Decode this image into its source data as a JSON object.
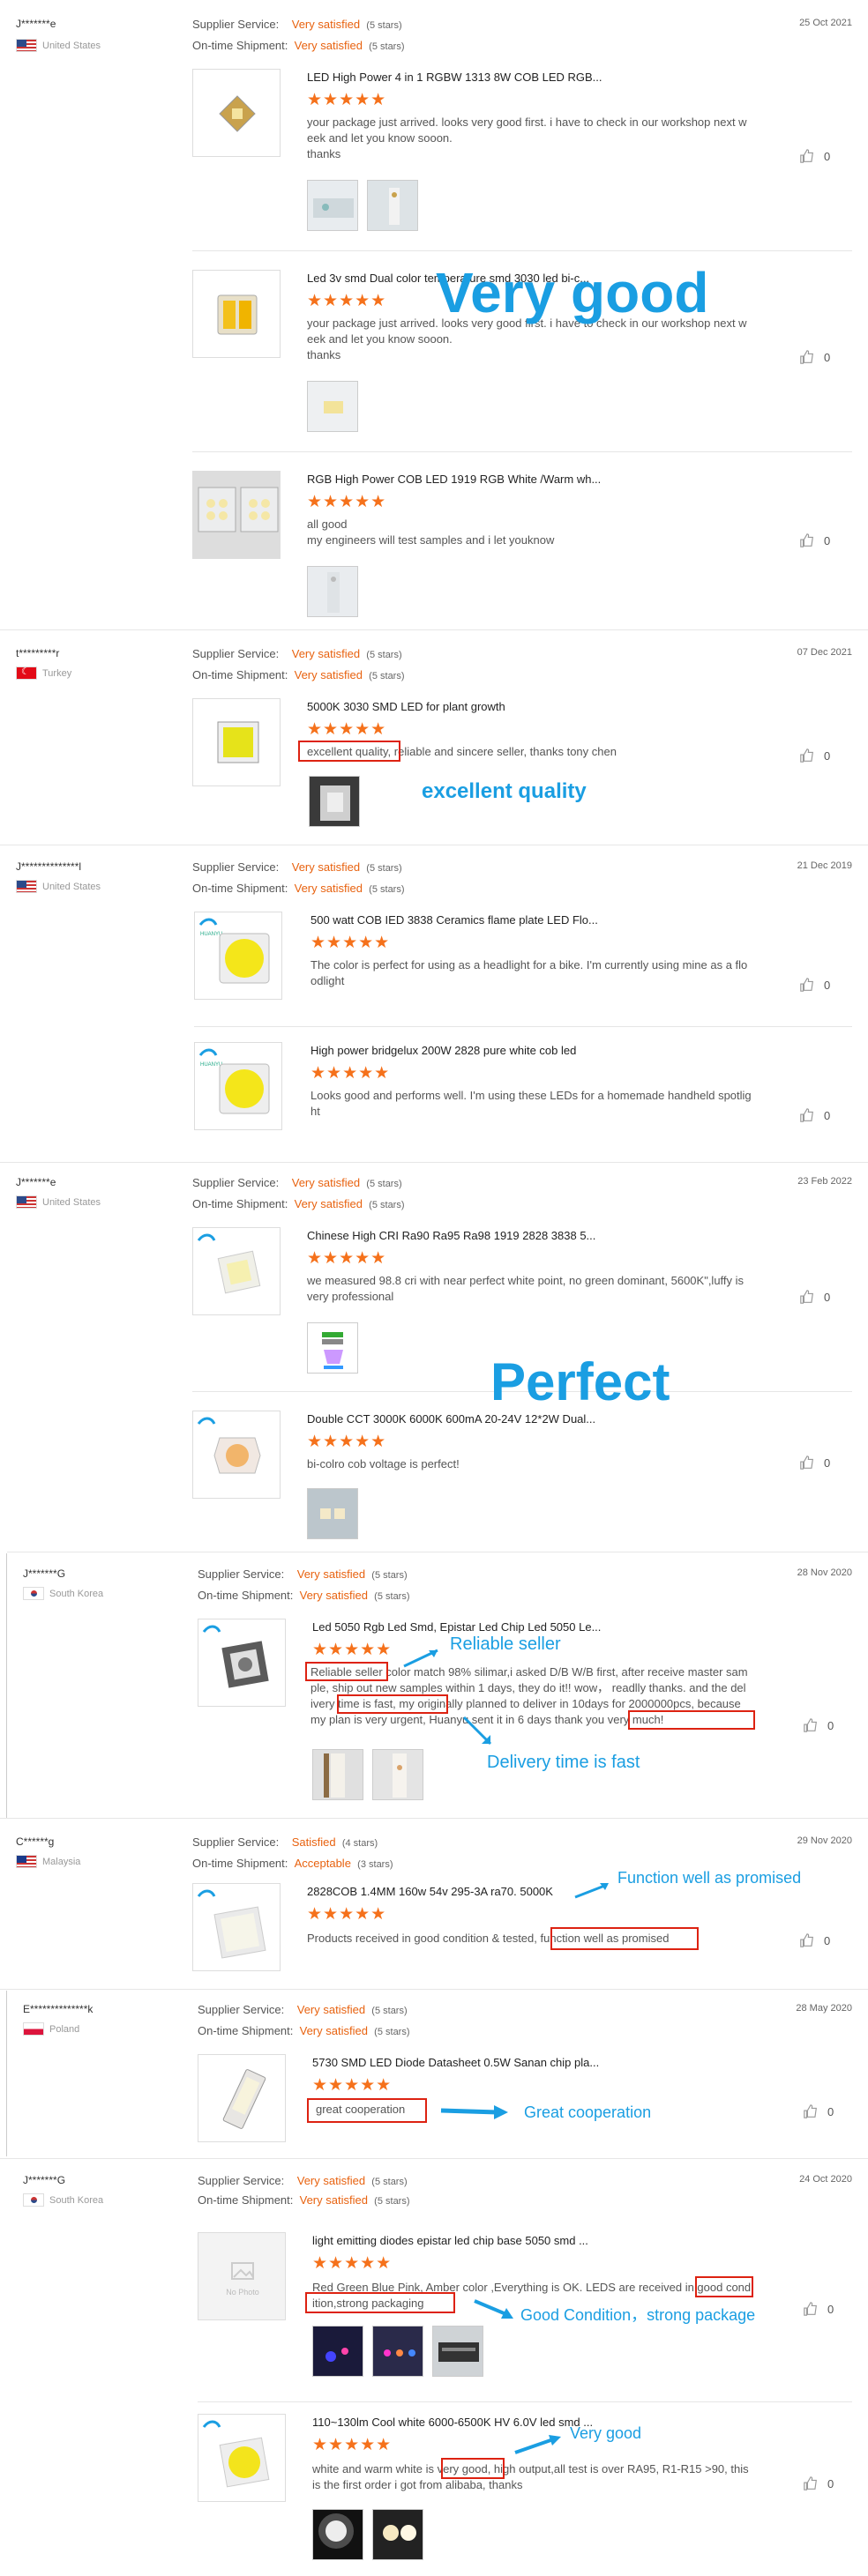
{
  "labels": {
    "supplier_service": "Supplier Service:",
    "ontime_shipment": "On-time Shipment:"
  },
  "overlays": {
    "very_good_big": "Very good",
    "excellent_quality": "excellent quality",
    "perfect": "Perfect",
    "reliable_seller": "Reliable seller",
    "delivery_fast": "Delivery time is fast",
    "function_well": "Function well as promised",
    "great_cooperation": "Great cooperation",
    "good_condition": "Good Condition，strong package",
    "very_good_small": "Very good"
  },
  "reviews": [
    {
      "user": "J*******e",
      "country": "United States",
      "flag": "us",
      "service": "Very satisfied",
      "service_stars": "(5 stars)",
      "shipment": "Very satisfied",
      "shipment_stars": "(5 stars)",
      "date": "25 Oct 2021",
      "items": [
        {
          "title": "LED High Power 4 in 1 RGBW 1313 8W COB LED RGB...",
          "stars": "★★★★★",
          "text": "your package just arrived. looks very good first. i have to check in our workshop next week and let you know sooon.\nthanks",
          "likes": "0"
        },
        {
          "title": "Led 3v smd Dual color temperature smd 3030 led bi-c...",
          "stars": "★★★★★",
          "text": "your package just arrived. looks very good first. i have to check in our workshop next week and let you know sooon.\nthanks",
          "likes": "0"
        },
        {
          "title": "RGB High Power COB LED 1919 RGB White /Warm wh...",
          "stars": "★★★★★",
          "text": "all good\nmy engineers will test samples and i let youknow",
          "likes": "0"
        }
      ]
    },
    {
      "user": "t*********r",
      "country": "Turkey",
      "flag": "tr",
      "service": "Very satisfied",
      "service_stars": "(5 stars)",
      "shipment": "Very satisfied",
      "shipment_stars": "(5 stars)",
      "date": "07 Dec 2021",
      "items": [
        {
          "title": "5000K 3030 SMD LED for plant growth",
          "stars": "★★★★★",
          "text": "excellent quality, reliable and sincere seller, thanks tony chen",
          "likes": "0"
        }
      ]
    },
    {
      "user": "J**************l",
      "country": "United States",
      "flag": "us",
      "service": "Very satisfied",
      "service_stars": "(5 stars)",
      "shipment": "Very satisfied",
      "shipment_stars": "(5 stars)",
      "date": "21 Dec 2019",
      "items": [
        {
          "title": "500 watt COB IED 3838 Ceramics flame plate LED Flo...",
          "stars": "★★★★★",
          "text": "The color is perfect for using as a headlight for a bike. I'm currently using mine as a floodlight",
          "likes": "0"
        },
        {
          "title": "High power bridgelux 200W 2828 pure white cob led",
          "stars": "★★★★★",
          "text": "Looks good and performs well. I'm using these LEDs for a homemade handheld spotlight",
          "likes": "0"
        }
      ]
    },
    {
      "user": "J*******e",
      "country": "United States",
      "flag": "us",
      "service": "Very satisfied",
      "service_stars": "(5 stars)",
      "shipment": "Very satisfied",
      "shipment_stars": "(5 stars)",
      "date": "23 Feb 2022",
      "items": [
        {
          "title": "Chinese High CRI Ra90 Ra95 Ra98 1919 2828 3838 5...",
          "stars": "★★★★★",
          "text": "we measured 98.8 cri with near perfect white point, no green dominant, 5600K\",luffy is very professional",
          "likes": "0"
        },
        {
          "title": "Double CCT 3000K 6000K 600mA 20-24V 12*2W Dual...",
          "stars": "★★★★★",
          "text": "bi-colro cob voltage is perfect!",
          "likes": "0"
        }
      ]
    },
    {
      "user": "J*******G",
      "country": "South Korea",
      "flag": "kr",
      "service": "Very satisfied",
      "service_stars": "(5 stars)",
      "shipment": "Very satisfied",
      "shipment_stars": "(5 stars)",
      "date": "28 Nov 2020",
      "items": [
        {
          "title": "Led 5050 Rgb Led Smd, Epistar Led Chip Led 5050 Le...",
          "stars": "★★★★★",
          "text": "Reliable seller color match 98% silimar,i asked D/B W/B first, after receive master sample, ship out new samples within 1 days, they do it!! wow， readlly thanks. and the delivery time is fast, my originally planned to deliver in 10days for 2000000pcs, because my plan is very urgent, Huanyu sent it in 6 days thank you very much!",
          "likes": "0"
        }
      ]
    },
    {
      "user": "C******g",
      "country": "Malaysia",
      "flag": "my",
      "service": "Satisfied",
      "service_stars": "(4 stars)",
      "shipment": "Acceptable",
      "shipment_stars": "(3 stars)",
      "date": "29 Nov 2020",
      "items": [
        {
          "title": "2828COB 1.4MM 160w 54v 295-3A ra70. 5000K",
          "stars": "★★★★★",
          "text": "Products received in good condition & tested, function well as promised",
          "likes": "0"
        }
      ]
    },
    {
      "user": "E**************k",
      "country": "Poland",
      "flag": "pl",
      "service": "Very satisfied",
      "service_stars": "(5 stars)",
      "shipment": "Very satisfied",
      "shipment_stars": "(5 stars)",
      "date": "28 May 2020",
      "items": [
        {
          "title": "5730 SMD LED Diode Datasheet 0.5W Sanan chip pla...",
          "stars": "★★★★★",
          "text": "great cooperation",
          "likes": "0"
        }
      ]
    },
    {
      "user": "J*******G",
      "country": "South Korea",
      "flag": "kr",
      "service": "Very satisfied",
      "service_stars": "(5 stars)",
      "shipment": "Very satisfied",
      "shipment_stars": "(5 stars)",
      "date": "24 Oct 2020",
      "items": [
        {
          "title": "light emitting diodes epistar led chip base 5050 smd ...",
          "stars": "★★★★★",
          "text": "Red Green Blue Pink, Amber color ,Everything is OK. LEDS are received in good condition,strong packaging",
          "likes": "0",
          "nophoto": "No Photo"
        },
        {
          "title": "110~130lm Cool white 6000-6500K HV 6.0V led smd ...",
          "stars": "★★★★★",
          "text": "white and warm white is very good, high output,all test is over RA95, R1-R15 >90, this is the first order i got from alibaba, thanks",
          "likes": "0"
        }
      ]
    }
  ]
}
